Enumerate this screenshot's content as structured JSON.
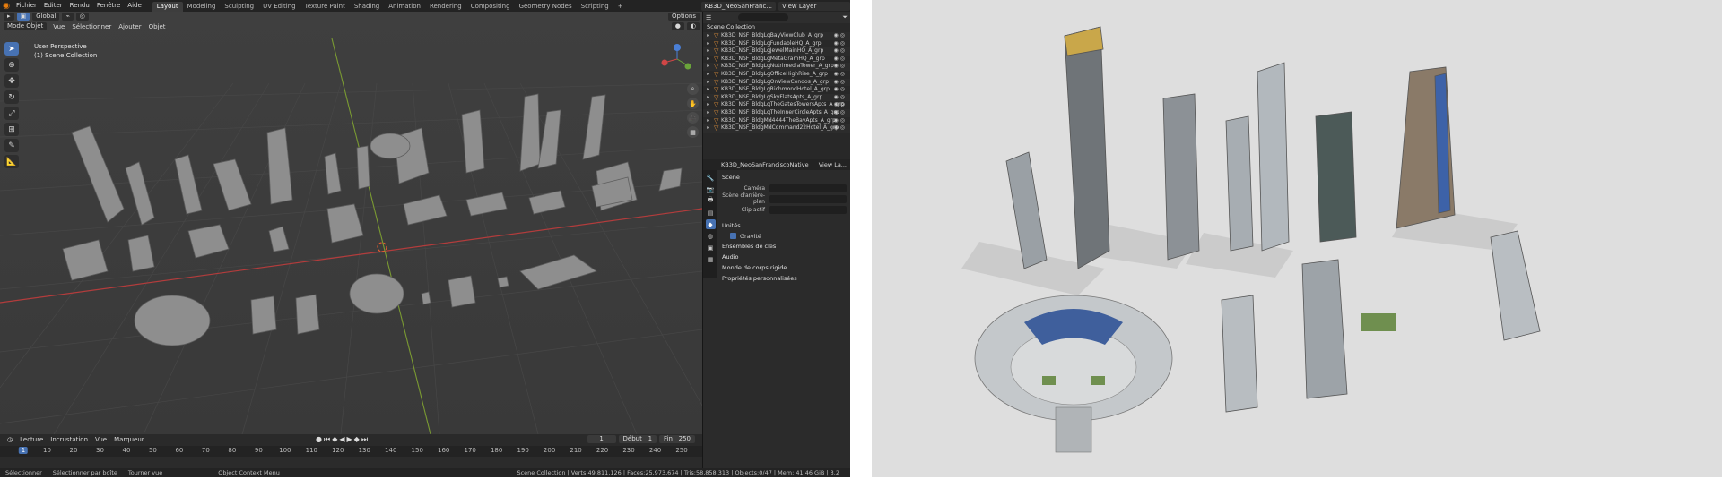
{
  "app": {
    "menu": [
      "Fichier",
      "Editer",
      "Rendu",
      "Fenêtre",
      "Aide"
    ],
    "workspaces": [
      "Layout",
      "Modeling",
      "Sculpting",
      "UV Editing",
      "Texture Paint",
      "Shading",
      "Animation",
      "Rendering",
      "Compositing",
      "Geometry Nodes",
      "Scripting"
    ],
    "active_workspace": "Layout",
    "scene_name": "KB3D_NeoSanFranc...",
    "view_layer": "View Layer"
  },
  "viewport": {
    "mode": "Mode Objet",
    "menus": [
      "Vue",
      "Sélectionner",
      "Ajouter",
      "Objet"
    ],
    "orientation": "Global",
    "options": "Options",
    "perspective_label": "User Perspective",
    "collection_label": "(1) Scene Collection",
    "gizmo_axes": [
      "Z",
      "Y",
      "X"
    ]
  },
  "timeline": {
    "menus": [
      "Lecture",
      "Incrustation",
      "Vue",
      "Marqueur"
    ],
    "current_frame": "1",
    "start_label": "Début",
    "start": "1",
    "end_label": "Fin",
    "end": "250",
    "ticks": [
      "1",
      "10",
      "20",
      "30",
      "40",
      "50",
      "60",
      "70",
      "80",
      "90",
      "100",
      "110",
      "120",
      "130",
      "140",
      "150",
      "160",
      "170",
      "180",
      "190",
      "200",
      "210",
      "220",
      "230",
      "240",
      "250"
    ]
  },
  "statusbar": {
    "items": [
      "Sélectionner",
      "Sélectionner par boîte",
      "Tourner vue",
      "Object Context Menu"
    ],
    "stats": "Scene Collection | Verts:49,811,126 | Faces:25,973,674 | Tris:58,858,313 | Objects:0/47 | Mem: 41.46 GiB | 3.2"
  },
  "outliner": {
    "root": "Scene Collection",
    "items": [
      "KB3D_NSF_BldgLgBayViewClub_A_grp",
      "KB3D_NSF_BldgLgFundableHQ_A_grp",
      "KB3D_NSF_BldgLgJewelMainHQ_A_grp",
      "KB3D_NSF_BldgLgMetaGramHQ_A_grp",
      "KB3D_NSF_BldgLgNutrimediaTower_A_grp",
      "KB3D_NSF_BldgLgOfficeHighRise_A_grp",
      "KB3D_NSF_BldgLgOnViewCondos_A_grp",
      "KB3D_NSF_BldgLgRichmondHotel_A_grp",
      "KB3D_NSF_BldgLgSkyFlatsApts_A_grp",
      "KB3D_NSF_BldgLgTheGatesTowersApts_A_grp",
      "KB3D_NSF_BldgLgTheInnerCircleApts_A_grp",
      "KB3D_NSF_BldgMd4444TheBayApts_A_grp",
      "KB3D_NSF_BldgMdCommand22Hotel_A_grp"
    ]
  },
  "properties": {
    "scene_name": "KB3D_NeoSanFranciscoNative",
    "view_layer": "View La...",
    "section_scene": "Scène",
    "camera_label": "Caméra",
    "background_label": "Scène d'arrière-plan",
    "clip_label": "Clip actif",
    "units": "Unités",
    "gravity": "Gravité",
    "keying_sets": "Ensembles de clés",
    "audio": "Audio",
    "rigidbody": "Monde de corps rigide",
    "custom_props": "Propriétés personnalisées"
  },
  "colors": {
    "accent": "#4772b3",
    "orange": "#e87d0d",
    "axis_x": "#b33c3c",
    "axis_y": "#7a9a32"
  }
}
